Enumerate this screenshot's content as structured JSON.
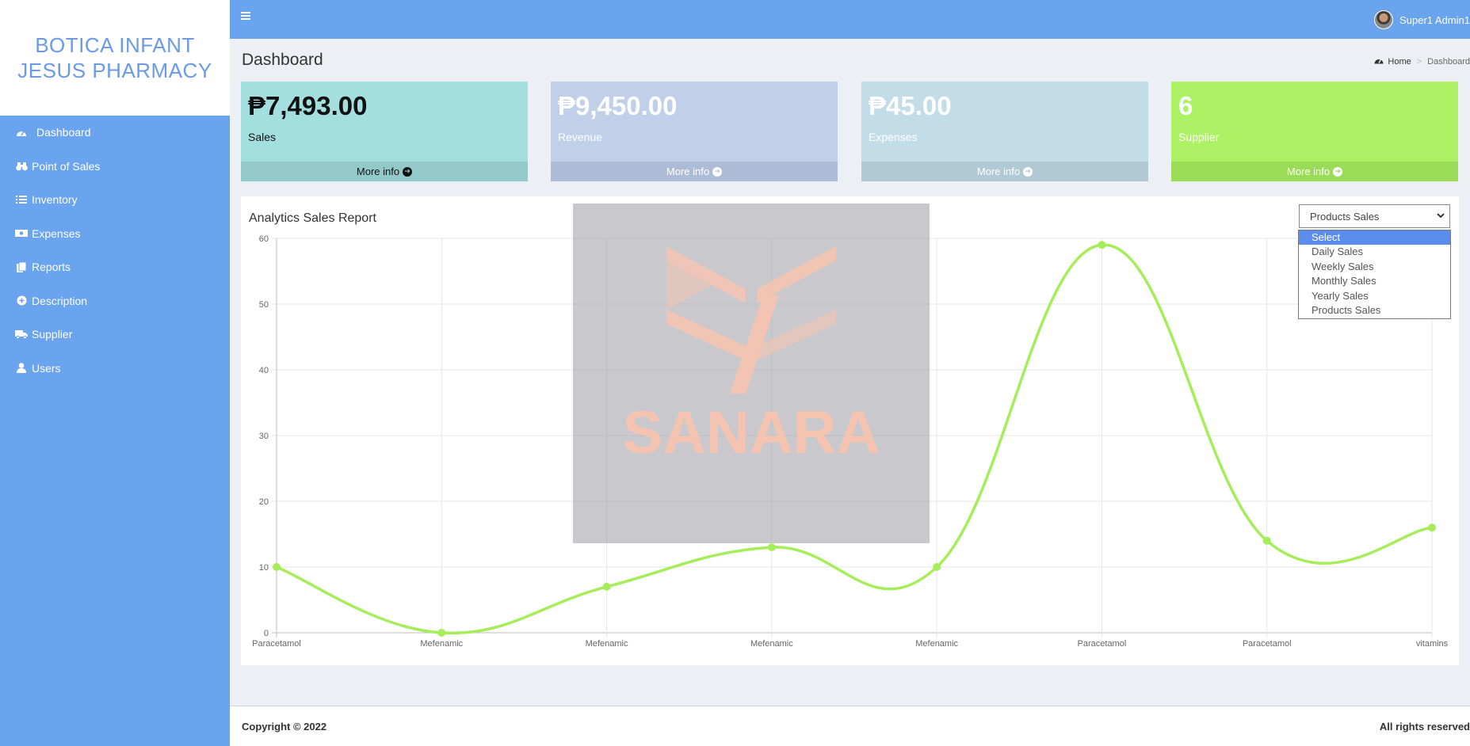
{
  "brand": {
    "line1": "BOTICA INFANT",
    "line2": "JESUS PHARMACY"
  },
  "sidebar": {
    "items": [
      {
        "label": "Dashboard",
        "icon": "dashboard-icon"
      },
      {
        "label": "Point of Sales",
        "icon": "binoculars-icon"
      },
      {
        "label": "Inventory",
        "icon": "list-icon"
      },
      {
        "label": "Expenses",
        "icon": "money-icon"
      },
      {
        "label": "Reports",
        "icon": "files-icon"
      },
      {
        "label": "Description",
        "icon": "circle-plus-icon"
      },
      {
        "label": "Supplier",
        "icon": "truck-icon"
      },
      {
        "label": "Users",
        "icon": "user-icon"
      }
    ]
  },
  "topbar": {
    "user_name": "Super1 Admin1"
  },
  "header": {
    "title": "Dashboard"
  },
  "breadcrumb": {
    "home": "Home",
    "separator": ">",
    "current": "Dashboard"
  },
  "stats": [
    {
      "value": "₱7,493.00",
      "label": "Sales",
      "footer": "More info"
    },
    {
      "value": "₱9,450.00",
      "label": "Revenue",
      "footer": "More info"
    },
    {
      "value": "₱45.00",
      "label": "Expenses",
      "footer": "More info"
    },
    {
      "value": "6",
      "label": "Supplier",
      "footer": "More info"
    }
  ],
  "report": {
    "title": "Analytics Sales Report",
    "select_value": "Products Sales",
    "options": [
      "Select",
      "Daily Sales",
      "Weekly Sales",
      "Monthly Sales",
      "Yearly Sales",
      "Products Sales"
    ]
  },
  "watermark": {
    "text": "SANARA"
  },
  "chart_data": {
    "type": "line",
    "title": "",
    "xlabel": "",
    "ylabel": "",
    "categories": [
      "Paracetamol",
      "Mefenamic",
      "Mefenamic",
      "Mefenamic",
      "Mefenamic",
      "Paracetamol",
      "Paracetamol",
      "vitamins"
    ],
    "series": [
      {
        "values": [
          10,
          0,
          7,
          13,
          10,
          59,
          14,
          16
        ]
      }
    ],
    "ylim": [
      0,
      60
    ],
    "yticks": [
      0,
      10,
      20,
      30,
      40,
      50,
      60
    ],
    "grid": true,
    "legend": "none",
    "line_color": "#a5ee5a"
  },
  "footer": {
    "copyright": "Copyright © 2022",
    "rights": "All rights reserved"
  }
}
